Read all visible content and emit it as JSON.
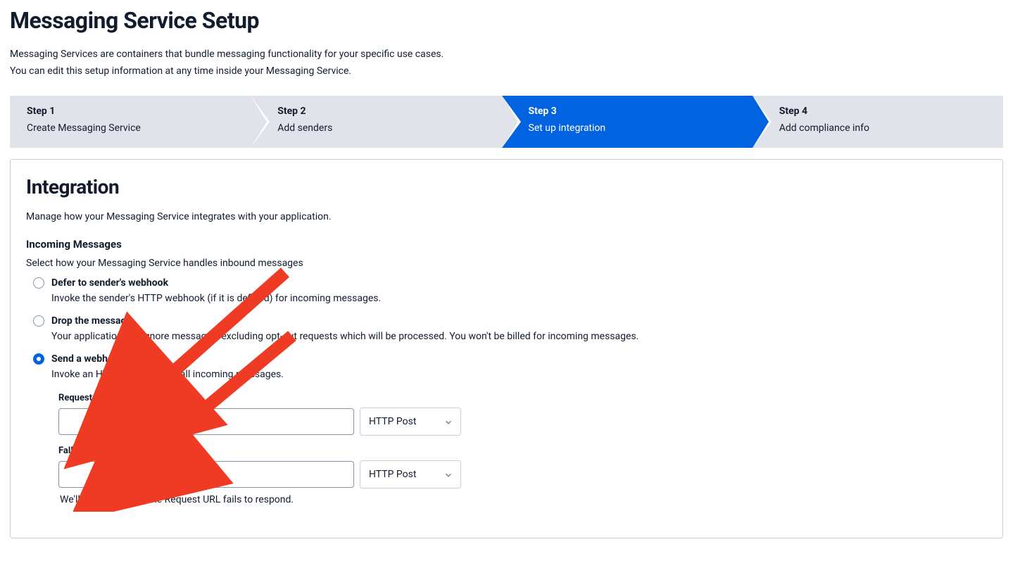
{
  "page": {
    "title": "Messaging Service Setup",
    "desc_line1": "Messaging Services are containers that bundle messaging functionality for your specific use cases.",
    "desc_line2": "You can edit this setup information at any time inside your Messaging Service."
  },
  "stepper": [
    {
      "title": "Step 1",
      "desc": "Create Messaging Service",
      "active": false
    },
    {
      "title": "Step 2",
      "desc": "Add senders",
      "active": false
    },
    {
      "title": "Step 3",
      "desc": "Set up integration",
      "active": true
    },
    {
      "title": "Step 4",
      "desc": "Add compliance info",
      "active": false
    }
  ],
  "panel": {
    "heading": "Integration",
    "desc": "Manage how your Messaging Service integrates with your application.",
    "incoming": {
      "heading": "Incoming Messages",
      "sub": "Select how your Messaging Service handles inbound messages",
      "options": [
        {
          "label": "Defer to sender's webhook",
          "desc": "Invoke the sender's HTTP webhook (if it is defined) for incoming messages.",
          "checked": false
        },
        {
          "label": "Drop the message",
          "desc": "Your application will ignore messages, excluding opt-out requests which will be processed. You won't be billed for incoming messages.",
          "checked": false
        },
        {
          "label": "Send a webhook",
          "desc": "Invoke an HTTP webhook for all incoming messages.",
          "checked": true
        }
      ],
      "request_url": {
        "label": "Request URL",
        "value": "",
        "method": "HTTP Post"
      },
      "fallback_url": {
        "label": "Fallback URL",
        "value": "",
        "method": "HTTP Post",
        "helper": "We'll only use this if the Request URL fails to respond."
      }
    }
  }
}
